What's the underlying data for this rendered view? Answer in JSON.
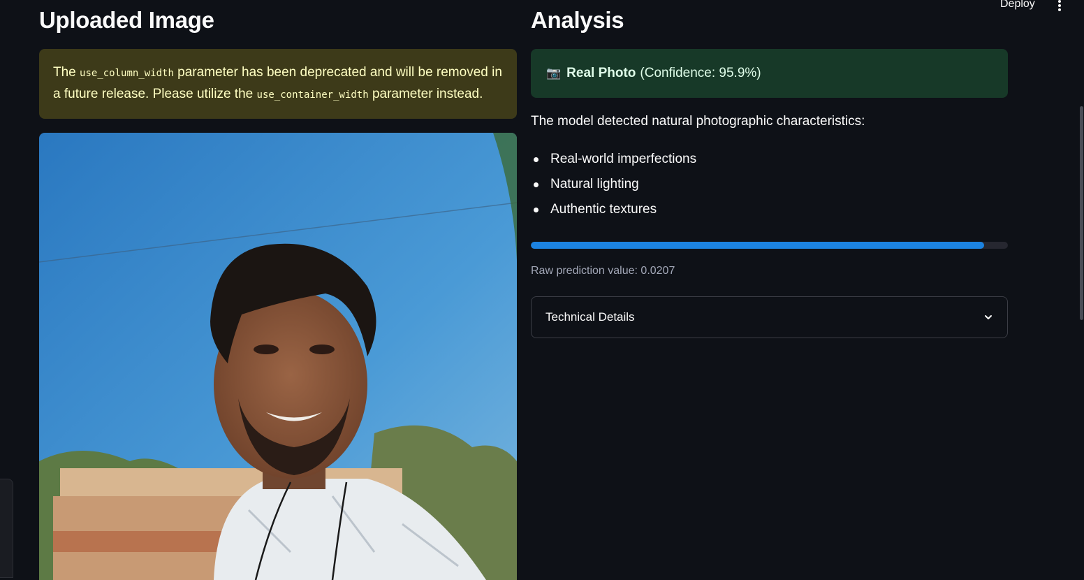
{
  "toolbar": {
    "deploy_label": "Deploy",
    "menu_icon": "kebab-menu-icon"
  },
  "left": {
    "title": "Uploaded Image",
    "warning": {
      "prefix": "The",
      "code1": "use_column_width",
      "mid": "parameter has been deprecated and will be removed in a future release. Please utilize the",
      "code2": "use_container_width",
      "suffix": "parameter instead."
    }
  },
  "right": {
    "title": "Analysis",
    "result": {
      "icon": "camera-icon",
      "label": "Real Photo",
      "confidence_text": "(Confidence: 95.9%)"
    },
    "description": "The model detected natural photographic characteristics:",
    "characteristics": [
      "Real-world imperfections",
      "Natural lighting",
      "Authentic textures"
    ],
    "progress_fraction": 0.95,
    "raw_prediction": "Raw prediction value: 0.0207",
    "expander_label": "Technical Details"
  },
  "colors": {
    "background": "#0e1117",
    "warning_bg": "#3d3a19",
    "success_bg": "#173928",
    "progress": "#1c83e1"
  }
}
